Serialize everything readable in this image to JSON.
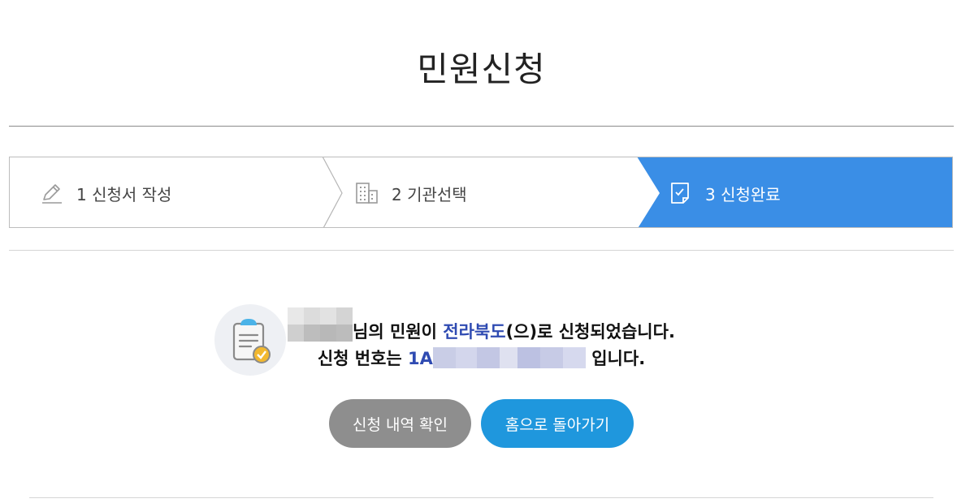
{
  "page": {
    "title": "민원신청"
  },
  "steps": [
    {
      "label": "1 신청서 작성",
      "icon": "pencil-icon",
      "active": false
    },
    {
      "label": "2 기관선택",
      "icon": "building-icon",
      "active": false
    },
    {
      "label": "3 신청완료",
      "icon": "document-check-icon",
      "active": true
    }
  ],
  "result": {
    "icon": "clipboard-check-icon",
    "line1_suffix": "님의 민원이 ",
    "agency": "전라북도",
    "line1_end": "(으)로 신청되었습니다.",
    "line2_prefix": "신청 번호는 ",
    "number_visible": "1A",
    "line2_end": " 입니다."
  },
  "buttons": {
    "history": "신청 내역 확인",
    "home": "홈으로 돌아가기"
  },
  "colors": {
    "active_step": "#3a8ee6",
    "agency_text": "#2f4bb2",
    "history_button": "#8e8e8e",
    "home_button": "#1f97dd"
  }
}
